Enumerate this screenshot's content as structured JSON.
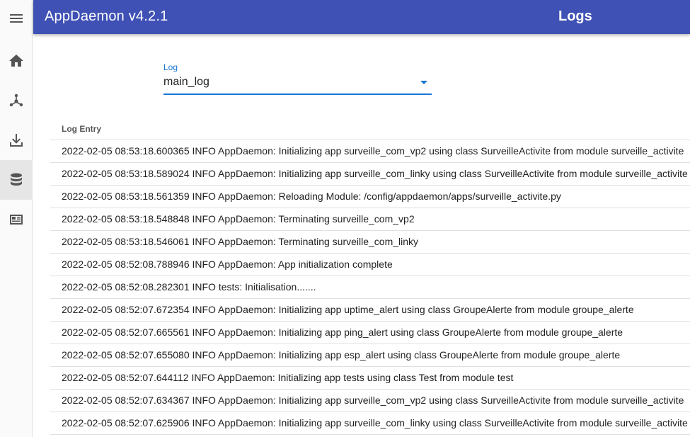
{
  "sidebar": {
    "items": [
      {
        "icon": "menu-icon"
      },
      {
        "icon": "home-icon"
      },
      {
        "icon": "hub-icon"
      },
      {
        "icon": "download-icon"
      },
      {
        "icon": "database-icon",
        "active": true
      },
      {
        "icon": "news-icon"
      }
    ]
  },
  "header": {
    "app_title": "AppDaemon v4.2.1",
    "page_title": "Logs",
    "bg_color": "#3f51b5"
  },
  "log_select": {
    "label": "Log",
    "value": "main_log",
    "accent_color": "#1976d2"
  },
  "table": {
    "header": "Log Entry",
    "rows": [
      "2022-02-05 08:53:18.600365 INFO AppDaemon: Initializing app surveille_com_vp2 using class SurveilleActivite from module surveille_activite",
      "2022-02-05 08:53:18.589024 INFO AppDaemon: Initializing app surveille_com_linky using class SurveilleActivite from module surveille_activite",
      "2022-02-05 08:53:18.561359 INFO AppDaemon: Reloading Module: /config/appdaemon/apps/surveille_activite.py",
      "2022-02-05 08:53:18.548848 INFO AppDaemon: Terminating surveille_com_vp2",
      "2022-02-05 08:53:18.546061 INFO AppDaemon: Terminating surveille_com_linky",
      "2022-02-05 08:52:08.788946 INFO AppDaemon: App initialization complete",
      "2022-02-05 08:52:08.282301 INFO tests: Initialisation.......",
      "2022-02-05 08:52:07.672354 INFO AppDaemon: Initializing app uptime_alert using class GroupeAlerte from module groupe_alerte",
      "2022-02-05 08:52:07.665561 INFO AppDaemon: Initializing app ping_alert using class GroupeAlerte from module groupe_alerte",
      "2022-02-05 08:52:07.655080 INFO AppDaemon: Initializing app esp_alert using class GroupeAlerte from module groupe_alerte",
      "2022-02-05 08:52:07.644112 INFO AppDaemon: Initializing app tests using class Test from module test",
      "2022-02-05 08:52:07.634367 INFO AppDaemon: Initializing app surveille_com_vp2 using class SurveilleActivite from module surveille_activite",
      "2022-02-05 08:52:07.625906 INFO AppDaemon: Initializing app surveille_com_linky using class SurveilleActivite from module surveille_activite"
    ]
  }
}
